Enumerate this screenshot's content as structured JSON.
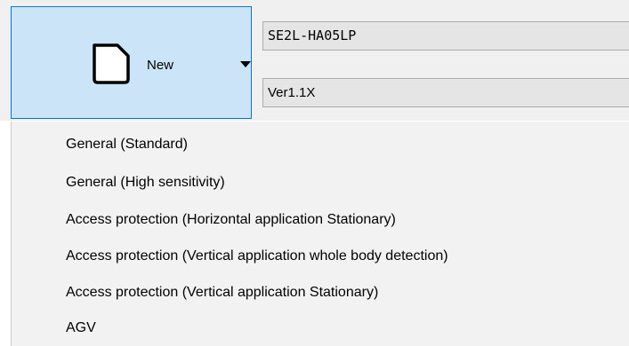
{
  "new_button": {
    "label": "New",
    "icon": "document-icon",
    "dropdown_icon": "caret-down-icon"
  },
  "model_combo": {
    "value": "SE2L-HA05LP"
  },
  "version_combo": {
    "value": "Ver1.1X"
  },
  "menu": {
    "items": [
      {
        "label": "General (Standard)"
      },
      {
        "label": "General (High sensitivity)"
      },
      {
        "label": "Access protection (Horizontal application Stationary)"
      },
      {
        "label": "Access protection (Vertical application whole body detection)"
      },
      {
        "label": "Access protection (Vertical application Stationary)"
      },
      {
        "label": "AGV"
      }
    ]
  },
  "colors": {
    "button_background": "#cce4f7",
    "button_border": "#0078d7",
    "combo_background": "#e5e5e5",
    "menu_background": "#f2f2f2"
  }
}
